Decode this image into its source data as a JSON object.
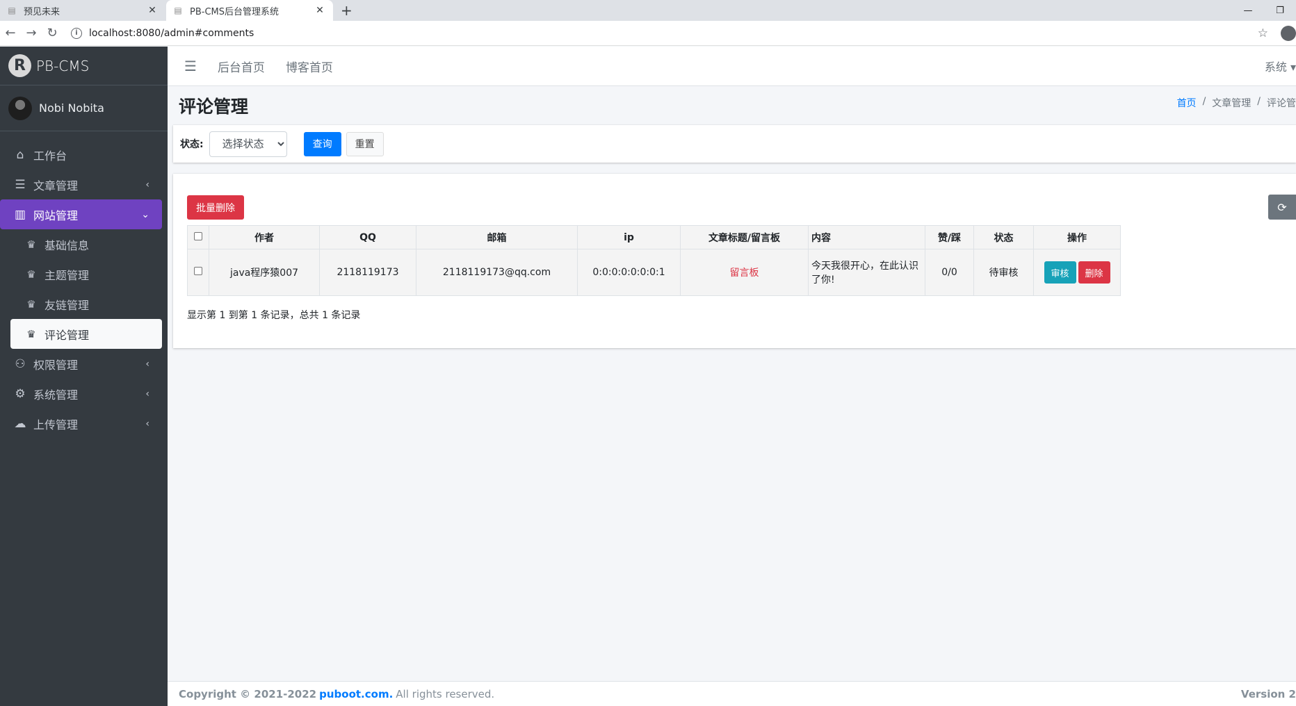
{
  "browser": {
    "tabs": [
      {
        "title": "预见未来",
        "close": "✕"
      },
      {
        "title": "PB-CMS后台管理系统",
        "close": "✕"
      }
    ],
    "new_tab": "+",
    "url": "localhost:8080/admin#comments",
    "window_controls": {
      "minimize": "—",
      "restore": "❐"
    }
  },
  "sidebar": {
    "brand": "PB-CMS",
    "brand_logo_letter": "R",
    "user": "Nobi Nobita",
    "menu": [
      {
        "label": "工作台",
        "icon": "home-icon"
      },
      {
        "label": "文章管理",
        "icon": "list-icon",
        "chevron": "‹"
      },
      {
        "label": "网站管理",
        "icon": "columns-icon",
        "chevron": "⌄"
      },
      {
        "label": "基础信息",
        "icon": "crown-icon"
      },
      {
        "label": "主题管理",
        "icon": "crown-icon"
      },
      {
        "label": "友链管理",
        "icon": "crown-icon"
      },
      {
        "label": "评论管理",
        "icon": "crown-icon"
      },
      {
        "label": "权限管理",
        "icon": "users-cog-icon",
        "chevron": "‹"
      },
      {
        "label": "系统管理",
        "icon": "gear-icon",
        "chevron": "‹"
      },
      {
        "label": "上传管理",
        "icon": "cloud-upload-icon",
        "chevron": "‹"
      }
    ]
  },
  "topnav": {
    "links": [
      "后台首页",
      "博客首页"
    ],
    "system": "系统 ▾"
  },
  "page": {
    "title": "评论管理",
    "breadcrumb": [
      "首页",
      "文章管理",
      "评论管"
    ]
  },
  "filter": {
    "label": "状态:",
    "select_value": "选择状态",
    "query": "查询",
    "reset": "重置"
  },
  "table": {
    "batch_delete": "批量删除",
    "headers": [
      "作者",
      "QQ",
      "邮箱",
      "ip",
      "文章标题/留言板",
      "内容",
      "赞/踩",
      "状态",
      "操作"
    ],
    "rows": [
      {
        "author": "java程序猿007",
        "qq": "2118119173",
        "email": "2118119173@qq.com",
        "ip": "0:0:0:0:0:0:0:1",
        "target": "留言板",
        "content": "今天我很开心，在此认识了你!",
        "likes": "0/0",
        "status": "待审核",
        "audit": "审核",
        "delete": "删除"
      }
    ],
    "summary": "显示第 1 到第 1 条记录，总共 1 条记录"
  },
  "footer": {
    "copyright": "Copyright © 2021-2022",
    "link": "puboot.com.",
    "rights": "All rights reserved.",
    "version": "Version 2"
  },
  "colors": {
    "sidebar_bg": "#343a40",
    "active_menu": "#6f42c1",
    "primary": "#007bff",
    "danger": "#dc3545",
    "info": "#17a2b8"
  }
}
